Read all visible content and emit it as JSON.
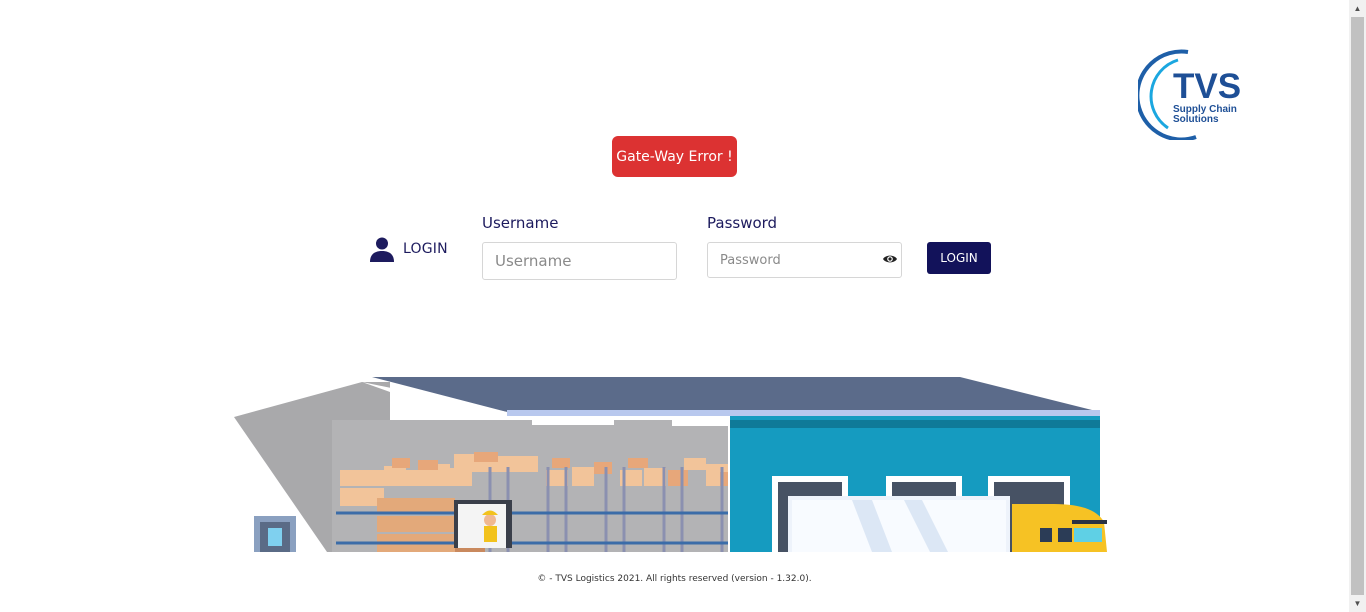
{
  "brand": {
    "logo_text": "TVS",
    "logo_subtitle_line1": "Supply Chain",
    "logo_subtitle_line2": "Solutions"
  },
  "alert": {
    "message": "Gate-Way Error !"
  },
  "login": {
    "section_label": "LOGIN",
    "username_label": "Username",
    "username_placeholder": "Username",
    "username_value": "",
    "password_label": "Password",
    "password_placeholder": "Password",
    "password_value": "",
    "submit_label": "LOGIN"
  },
  "footer": {
    "text": "© - TVS Logistics 2021. All rights reserved (version - 1.32.0)."
  },
  "colors": {
    "primary": "#12125a",
    "error": "#dc3232",
    "label": "#1d1b5e",
    "logo_blue": "#1e5fa8",
    "logo_cyan": "#1ba7e0"
  },
  "icons": {
    "user": "user-icon",
    "eye": "eye-icon",
    "scroll_up": "scroll-up-arrow",
    "scroll_down": "scroll-down-arrow"
  }
}
